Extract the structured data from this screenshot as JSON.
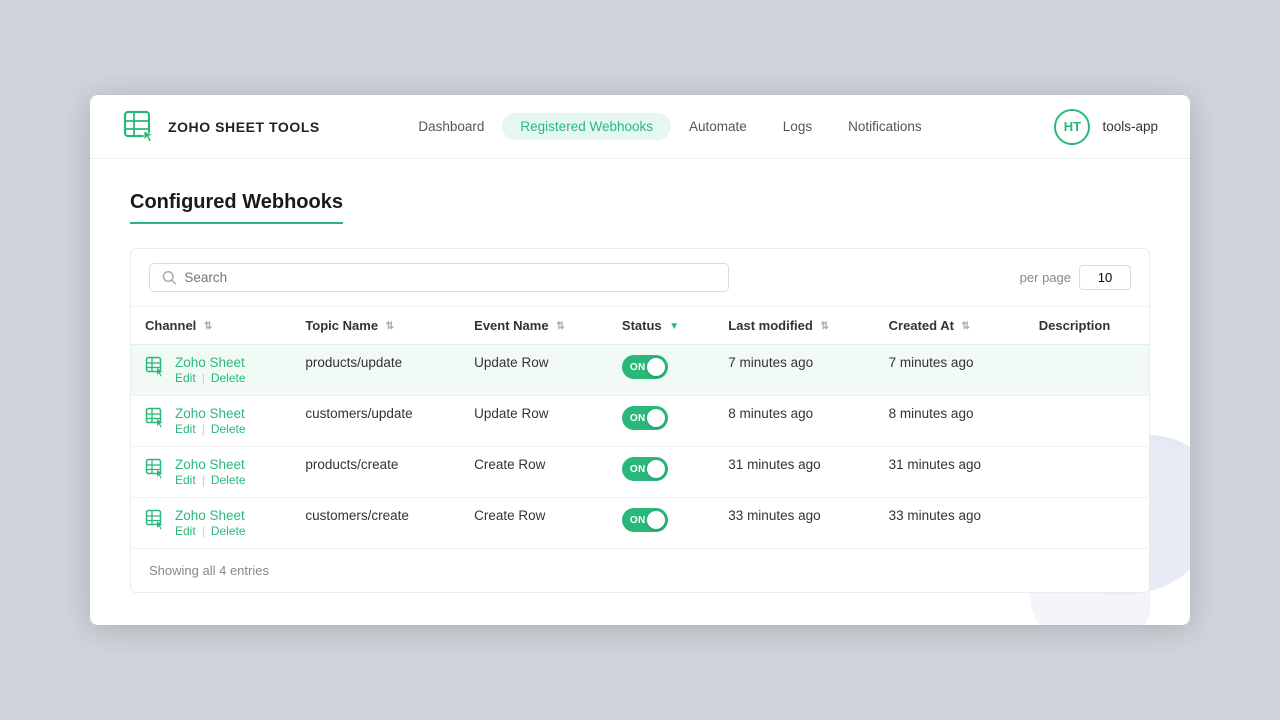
{
  "header": {
    "logo_text": "ZOHO SHEET TOOLS",
    "nav": [
      {
        "label": "Dashboard",
        "active": false
      },
      {
        "label": "Registered Webhooks",
        "active": true
      },
      {
        "label": "Automate",
        "active": false
      },
      {
        "label": "Logs",
        "active": false
      },
      {
        "label": "Notifications",
        "active": false
      }
    ],
    "avatar_initials": "HT",
    "app_name": "tools-app"
  },
  "page": {
    "title": "Configured Webhooks"
  },
  "search": {
    "placeholder": "Search",
    "value": ""
  },
  "pagination": {
    "per_page_label": "per page",
    "per_page_value": "10"
  },
  "table": {
    "columns": [
      {
        "label": "Channel",
        "sort": true,
        "active": false
      },
      {
        "label": "Topic Name",
        "sort": true,
        "active": false
      },
      {
        "label": "Event Name",
        "sort": true,
        "active": false
      },
      {
        "label": "Status",
        "sort": true,
        "active": true
      },
      {
        "label": "Last modified",
        "sort": true,
        "active": false
      },
      {
        "label": "Created At",
        "sort": true,
        "active": false
      },
      {
        "label": "Description",
        "sort": false,
        "active": false
      }
    ],
    "rows": [
      {
        "channel": "Zoho Sheet",
        "topic": "products/update",
        "event": "Update Row",
        "status": "ON",
        "last_modified": "7 minutes ago",
        "created_at": "7 minutes ago",
        "description": "",
        "highlighted": true
      },
      {
        "channel": "Zoho Sheet",
        "topic": "customers/update",
        "event": "Update Row",
        "status": "ON",
        "last_modified": "8 minutes ago",
        "created_at": "8 minutes ago",
        "description": "",
        "highlighted": false
      },
      {
        "channel": "Zoho Sheet",
        "topic": "products/create",
        "event": "Create Row",
        "status": "ON",
        "last_modified": "31 minutes ago",
        "created_at": "31 minutes ago",
        "description": "",
        "highlighted": false
      },
      {
        "channel": "Zoho Sheet",
        "topic": "customers/create",
        "event": "Create Row",
        "status": "ON",
        "last_modified": "33 minutes ago",
        "created_at": "33 minutes ago",
        "description": "",
        "highlighted": false
      }
    ],
    "footer": "Showing all 4 entries",
    "edit_label": "Edit",
    "delete_label": "Delete"
  }
}
